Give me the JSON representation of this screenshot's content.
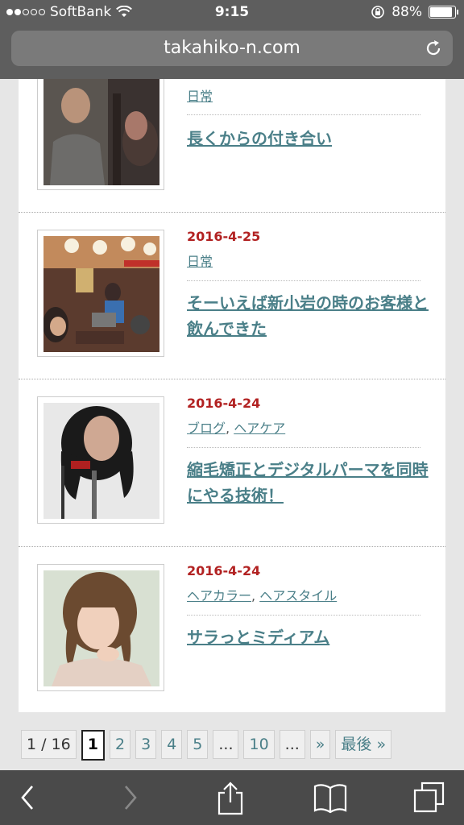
{
  "statusbar": {
    "carrier": "SoftBank",
    "time": "9:15",
    "battery": "88%",
    "signal_bars_filled": 2,
    "signal_bars_total": 5,
    "battery_level": 0.88
  },
  "browser": {
    "url": "takahiko-n.com"
  },
  "posts": [
    {
      "date": "",
      "categories": [
        "日常"
      ],
      "title": "長くからの付き合い"
    },
    {
      "date": "2016-4-25",
      "categories": [
        "日常"
      ],
      "title": "そーいえば新小岩の時のお客様と飲んできた"
    },
    {
      "date": "2016-4-24",
      "categories": [
        "ブログ",
        "ヘアケア"
      ],
      "title": "縮毛矯正とデジタルパーマを同時にやる技術！"
    },
    {
      "date": "2016-4-24",
      "categories": [
        "ヘアカラー",
        "ヘアスタイル"
      ],
      "title": "サラっとミディアム"
    }
  ],
  "pagination": {
    "info": "1 / 16",
    "current": "1",
    "pages": [
      "2",
      "3",
      "4",
      "5"
    ],
    "ellipsis1": "...",
    "page10": "10",
    "ellipsis2": "...",
    "next": "»",
    "last": "最後 »"
  },
  "colors": {
    "link": "#4a7f88",
    "date": "#b22222"
  },
  "icons": {
    "back": "chevron-left-icon",
    "forward": "chevron-right-icon",
    "share": "share-icon",
    "bookmarks": "book-icon",
    "tabs": "tabs-icon"
  }
}
